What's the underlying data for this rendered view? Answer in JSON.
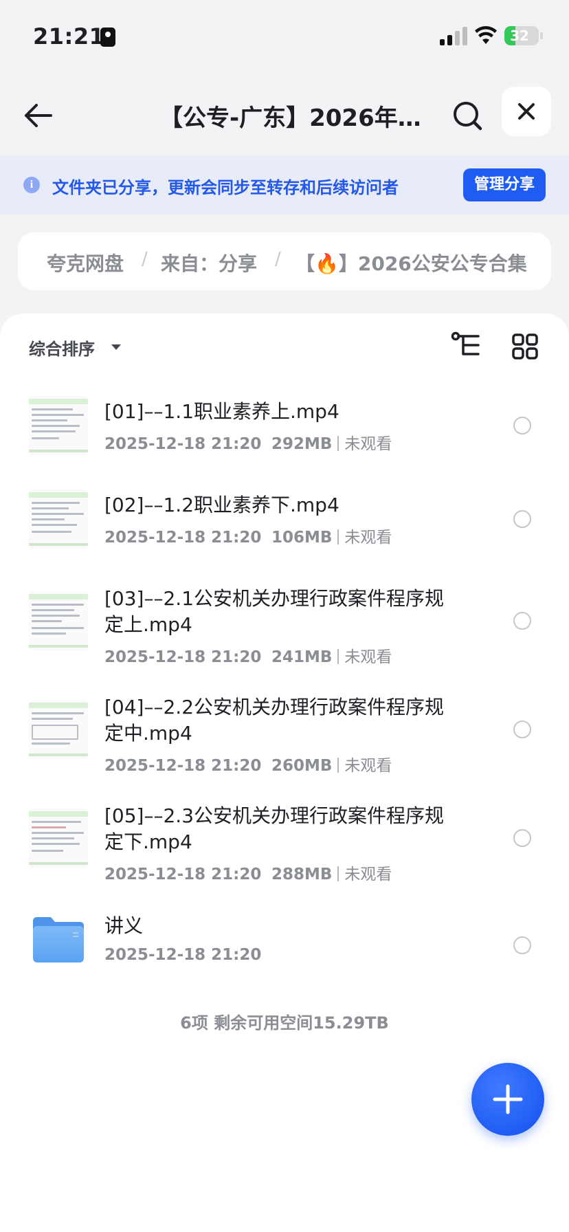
{
  "status_bar": {
    "time": "21:21",
    "battery": "32",
    "battery_level": 0.32
  },
  "nav": {
    "title": "【公专-广东】2026年…"
  },
  "banner": {
    "info_icon": "i",
    "text": "文件夹已分享，更新会同步至转存和后续访问者",
    "button": "管理分享"
  },
  "breadcrumb": {
    "items": [
      "夸克网盘",
      "来自：分享",
      "【🔥】2026公安公专合集"
    ],
    "separator": "/"
  },
  "toolbar": {
    "sort_label": "综合排序"
  },
  "files": [
    {
      "name": "[01]––1.1职业素养上.mp4",
      "date": "2025-12-18 21:20",
      "size": "292MB",
      "status": "未观看",
      "type": "video"
    },
    {
      "name": "[02]––1.2职业素养下.mp4",
      "date": "2025-12-18 21:20",
      "size": "106MB",
      "status": "未观看",
      "type": "video"
    },
    {
      "name": "[03]––2.1公安机关办理行政案件程序规定上.mp4",
      "date": "2025-12-18 21:20",
      "size": "241MB",
      "status": "未观看",
      "type": "video"
    },
    {
      "name": "[04]––2.2公安机关办理行政案件程序规定中.mp4",
      "date": "2025-12-18 21:20",
      "size": "260MB",
      "status": "未观看",
      "type": "video"
    },
    {
      "name": "[05]––2.3公安机关办理行政案件程序规定下.mp4",
      "date": "2025-12-18 21:20",
      "size": "288MB",
      "status": "未观看",
      "type": "video"
    },
    {
      "name": "讲义",
      "date": "2025-12-18 21:20",
      "type": "folder"
    }
  ],
  "footer": {
    "summary": "6项 剩余可用空间15.29TB"
  },
  "colors": {
    "accent": "#1e5cf2",
    "banner_bg": "#e8ecf9",
    "battery": "#34c759"
  },
  "icons": [
    "back-arrow-icon",
    "search-icon",
    "close-icon",
    "info-icon",
    "tree-view-icon",
    "grid-view-icon",
    "folder-icon",
    "plus-icon"
  ]
}
